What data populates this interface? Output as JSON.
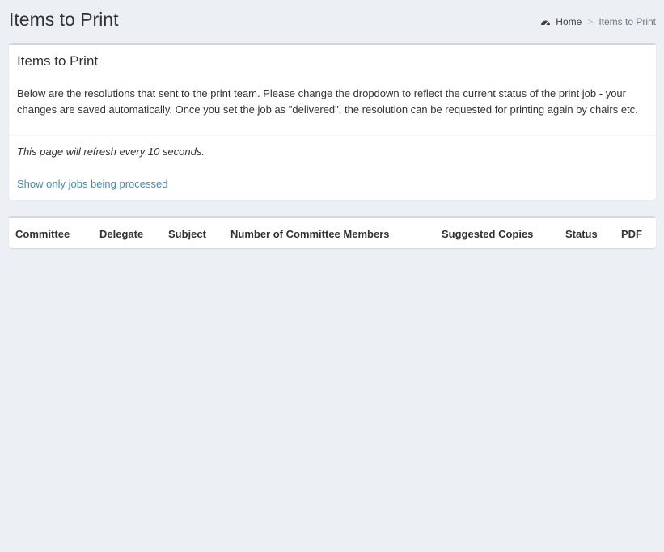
{
  "header": {
    "title": "Items to Print",
    "breadcrumb": {
      "home_icon": "dashboard-icon",
      "home_label": "Home",
      "separator": ">",
      "current": "Items to Print"
    }
  },
  "info_box": {
    "title": "Items to Print",
    "description": "Below are the resolutions that sent to the print team. Please change the dropdown to reflect the current status of the print job - your changes are saved automatically. Once you set the job as \"delivered\", the resolution can be requested for printing again by chairs etc.",
    "refresh_note": "This page will refresh every 10 seconds.",
    "filter_link": "Show only jobs being processed"
  },
  "table": {
    "columns": [
      "Committee",
      "Delegate",
      "Subject",
      "Number of Committee Members",
      "Suggested Copies",
      "Status",
      "PDF"
    ],
    "rows": []
  },
  "colors": {
    "background": "#ecf0f5",
    "link": "#3c8dbc",
    "box_border": "#d2d6de"
  }
}
